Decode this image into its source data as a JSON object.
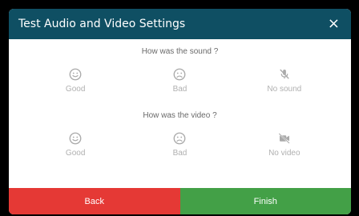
{
  "dialog": {
    "title": "Test Audio and Video Settings",
    "close_icon": "×"
  },
  "sound": {
    "question": "How was the sound ?",
    "options": [
      {
        "label": "Good",
        "icon": "smile-icon"
      },
      {
        "label": "Bad",
        "icon": "frown-icon"
      },
      {
        "label": "No sound",
        "icon": "mic-off-icon"
      }
    ]
  },
  "video": {
    "question": "How was the video ?",
    "options": [
      {
        "label": "Good",
        "icon": "smile-icon"
      },
      {
        "label": "Bad",
        "icon": "frown-icon"
      },
      {
        "label": "No video",
        "icon": "video-off-icon"
      }
    ]
  },
  "footer": {
    "back_label": "Back",
    "finish_label": "Finish"
  },
  "colors": {
    "header": "#0f4f63",
    "back": "#e53935",
    "finish": "#43a047",
    "option_text": "#b0b0b0"
  }
}
